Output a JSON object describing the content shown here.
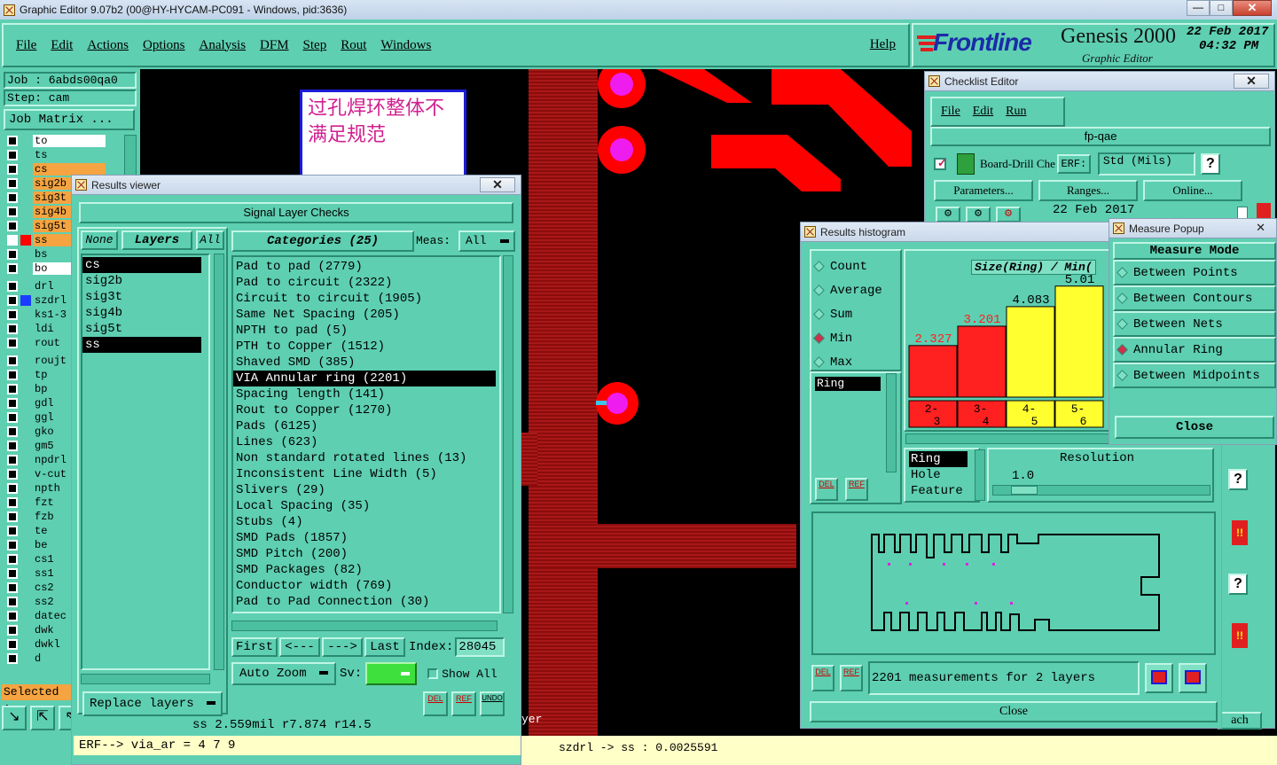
{
  "window": {
    "title": "Graphic Editor 9.07b2 (00@HY-HYCAM-PC091 - Windows, pid:3636)"
  },
  "menu": [
    "File",
    "Edit",
    "Actions",
    "Options",
    "Analysis",
    "DFM",
    "Step",
    "Rout",
    "Windows"
  ],
  "help": "Help",
  "brand": {
    "logo": "Frontline",
    "product": "Genesis 2000",
    "subtitle": "Graphic Editor",
    "date": "22 Feb 2017",
    "time": "04:32 PM"
  },
  "job": {
    "job": "Job  :  6abds00qa0",
    "step": "Step: cam",
    "matrix_btn": "Job Matrix ..."
  },
  "layers": [
    {
      "name": "to",
      "color": "#ffffff",
      "swatch": "#5ecfb1",
      "sel": false
    },
    {
      "name": "ts",
      "color": "#5ecfb1",
      "swatch": "#5ecfb1",
      "sel": false
    },
    {
      "name": "cs",
      "color": "#f5a441",
      "swatch": "#5ecfb1",
      "sel": false
    },
    {
      "name": "sig2b",
      "color": "#f5a441",
      "swatch": "#5ecfb1",
      "sel": false
    },
    {
      "name": "sig3t",
      "color": "#f5a441",
      "swatch": "#5ecfb1",
      "sel": false
    },
    {
      "name": "sig4b",
      "color": "#f5a441",
      "swatch": "#5ecfb1",
      "sel": false
    },
    {
      "name": "sig5t",
      "color": "#f5a441",
      "swatch": "#5ecfb1",
      "sel": false
    },
    {
      "name": "ss",
      "color": "#f5a441",
      "swatch": "#ff0000",
      "sel": true
    },
    {
      "name": "bs",
      "color": "#5ecfb1",
      "swatch": "#5ecfb1",
      "sel": false
    },
    {
      "name": "bo",
      "color": "#ffffff",
      "swatch": "#5ecfb1",
      "sel": false
    },
    {
      "name": "drl",
      "color": "#5ecfb1",
      "swatch": "#5ecfb1",
      "sel": false,
      "gap": true
    },
    {
      "name": "szdrl",
      "color": "#5ecfb1",
      "swatch": "#1a3cff",
      "sel": false
    },
    {
      "name": "ks1-3",
      "color": "#5ecfb1",
      "swatch": "#5ecfb1",
      "sel": false
    },
    {
      "name": "ldi",
      "color": "#5ecfb1",
      "swatch": "#5ecfb1",
      "sel": false
    },
    {
      "name": "rout",
      "color": "#5ecfb1",
      "swatch": "#5ecfb1",
      "sel": false
    },
    {
      "name": "roujt",
      "color": "#5ecfb1",
      "swatch": "#5ecfb1",
      "sel": false,
      "gap": true
    },
    {
      "name": "tp",
      "color": "#5ecfb1",
      "swatch": "#5ecfb1",
      "sel": false
    },
    {
      "name": "bp",
      "color": "#5ecfb1",
      "swatch": "#5ecfb1",
      "sel": false
    },
    {
      "name": "gdl",
      "color": "#5ecfb1",
      "swatch": "#5ecfb1",
      "sel": false
    },
    {
      "name": "ggl",
      "color": "#5ecfb1",
      "swatch": "#5ecfb1",
      "sel": false
    },
    {
      "name": "gko",
      "color": "#5ecfb1",
      "swatch": "#5ecfb1",
      "sel": false
    },
    {
      "name": "gm5",
      "color": "#5ecfb1",
      "swatch": "#5ecfb1",
      "sel": false
    },
    {
      "name": "npdrl",
      "color": "#5ecfb1",
      "swatch": "#5ecfb1",
      "sel": false
    },
    {
      "name": "v-cut",
      "color": "#5ecfb1",
      "swatch": "#5ecfb1",
      "sel": false
    },
    {
      "name": "npth",
      "color": "#5ecfb1",
      "swatch": "#5ecfb1",
      "sel": false
    },
    {
      "name": "fzt",
      "color": "#5ecfb1",
      "swatch": "#5ecfb1",
      "sel": false
    },
    {
      "name": "fzb",
      "color": "#5ecfb1",
      "swatch": "#5ecfb1",
      "sel": false
    },
    {
      "name": "te",
      "color": "#5ecfb1",
      "swatch": "#5ecfb1",
      "sel": false
    },
    {
      "name": "be",
      "color": "#5ecfb1",
      "swatch": "#5ecfb1",
      "sel": false
    },
    {
      "name": "cs1",
      "color": "#5ecfb1",
      "swatch": "#5ecfb1",
      "sel": false
    },
    {
      "name": "ss1",
      "color": "#5ecfb1",
      "swatch": "#5ecfb1",
      "sel": false
    },
    {
      "name": "cs2",
      "color": "#5ecfb1",
      "swatch": "#5ecfb1",
      "sel": false
    },
    {
      "name": "ss2",
      "color": "#5ecfb1",
      "swatch": "#5ecfb1",
      "sel": false
    },
    {
      "name": "datec",
      "color": "#5ecfb1",
      "swatch": "#5ecfb1",
      "sel": false
    },
    {
      "name": "dwk",
      "color": "#5ecfb1",
      "swatch": "#5ecfb1",
      "sel": false
    },
    {
      "name": "dwkl",
      "color": "#5ecfb1",
      "swatch": "#5ecfb1",
      "sel": false
    },
    {
      "name": "d",
      "color": "#5ecfb1",
      "swatch": "#5ecfb1",
      "sel": false
    }
  ],
  "selected_label": "Selected :",
  "note": {
    "line1": "过孔焊环整体不",
    "line2": "满足规范"
  },
  "results_viewer": {
    "title": "Results viewer",
    "heading": "Signal Layer Checks",
    "none": "None",
    "layers": "Layers",
    "all": "All",
    "layer_list": [
      "cs",
      "sig2b",
      "sig3t",
      "sig4b",
      "sig5t",
      "ss"
    ],
    "categories_label": "Categories (25)",
    "meas_label": "Meas:",
    "meas_value": "All",
    "categories": [
      "Pad to pad (2779)",
      "Pad to circuit (2322)",
      "Circuit to circuit (1905)",
      "Same Net Spacing (205)",
      "NPTH to pad (5)",
      "PTH to Copper (1512)",
      "Shaved SMD (385)",
      "VIA Annular ring (2201)",
      "Spacing length (141)",
      "Rout to Copper (1270)",
      "Pads (6125)",
      "Lines (623)",
      "Non standard rotated lines (13)",
      "Inconsistent Line Width (5)",
      "Slivers (29)",
      "Local Spacing (35)",
      "Stubs (4)",
      "SMD Pads (1857)",
      "SMD Pitch (200)",
      "SMD Packages (82)",
      "Conductor width (769)",
      "Pad to Pad Connection (30)"
    ],
    "selected_category": 7,
    "nav": {
      "first": "First",
      "prev": "<---",
      "next": "--->",
      "last": "Last",
      "index_label": "Index:",
      "index_value": "28045"
    },
    "auto_zoom": "Auto Zoom",
    "sv": "Sv:",
    "show_all": "Show All",
    "replace_layers": "Replace layers",
    "del": "DEL",
    "ref": "REF",
    "undo": "UNDO",
    "status": "ss 2.559mil  r7.874  r14.5",
    "erf": "ERF--> via_ar = 4 7 9"
  },
  "canvas_status": {
    "yer": "yer",
    "measure": "szdrl -> ss : 0.0025591"
  },
  "checklist": {
    "title": "Checklist Editor",
    "menu": [
      "File",
      "Edit",
      "Run"
    ],
    "name": "fp-qae",
    "item": "Board-Drill Che",
    "erf_label": "ERF:",
    "erf_value": "Std (Mils)",
    "help": "?",
    "params": "Parameters...",
    "ranges": "Ranges...",
    "online": "Online...",
    "date": "22 Feb 2017",
    "bang": "!!",
    "q": "?",
    "ach": "ach"
  },
  "histogram": {
    "title": "Results histogram",
    "modes": [
      "Count",
      "Average",
      "Sum",
      "Min",
      "Max"
    ],
    "selected_mode": 3,
    "chart_title": "Size(Ring) / Min(",
    "ring_label": "Ring",
    "fields": [
      "Ring",
      "Hole",
      "Feature"
    ],
    "resolution_label": "Resolution",
    "resolution_value": "1.0",
    "summary": "2201 measurements for 2 layers",
    "close": "Close",
    "del": "DEL",
    "ref": "REF"
  },
  "chart_data": {
    "type": "bar",
    "title": "Size(Ring) / Min(",
    "categories": [
      "2-3",
      "3-4",
      "4-5",
      "5-6"
    ],
    "values": [
      2.327,
      3.201,
      4.083,
      5.01
    ],
    "colors": [
      "#ff2020",
      "#ff2020",
      "#ffff30",
      "#ffff30"
    ]
  },
  "measure": {
    "title": "Measure Popup",
    "heading": "Measure Mode",
    "options": [
      "Between Points",
      "Between Contours",
      "Between Nets",
      "Annular Ring",
      "Between Midpoints"
    ],
    "selected": 3,
    "close": "Close"
  }
}
